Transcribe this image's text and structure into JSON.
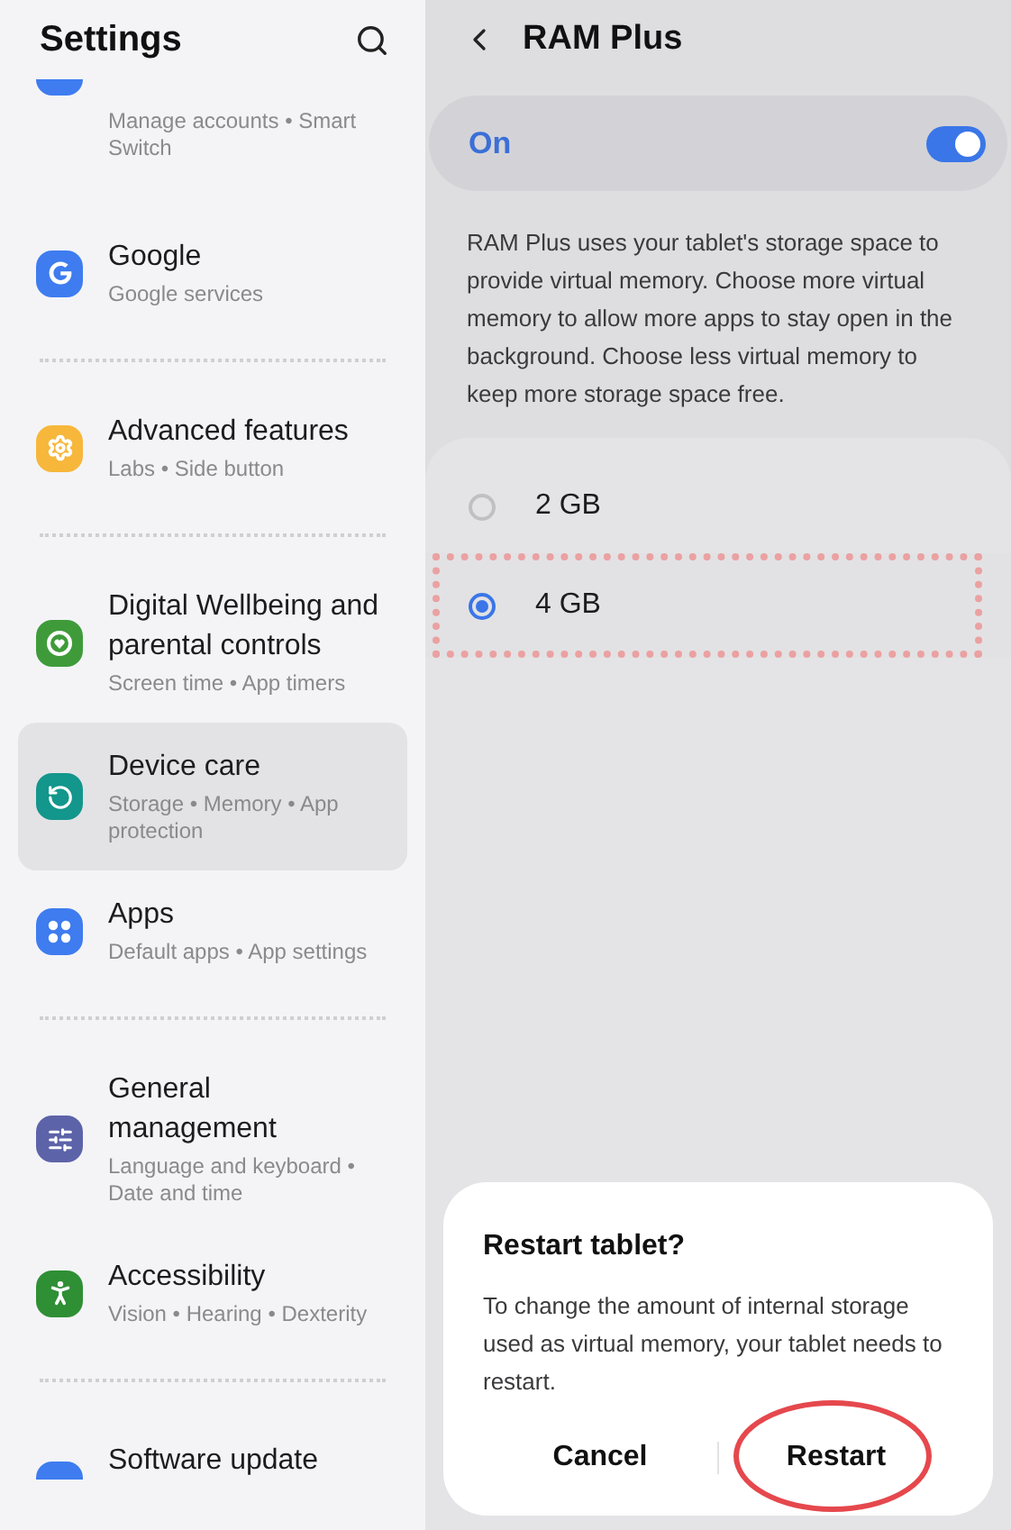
{
  "sidebar": {
    "title": "Settings",
    "groups": [
      {
        "items": [
          {
            "kind": "backup",
            "subtitle": "Manage accounts • Smart Switch",
            "color": "#3e7cf0",
            "selected": false
          },
          {
            "kind": "google",
            "title": "Google",
            "subtitle": "Google services",
            "color": "#3e7cf0",
            "selected": false
          }
        ]
      },
      {
        "items": [
          {
            "kind": "advanced",
            "title": "Advanced features",
            "subtitle": "Labs • Side button",
            "color": "#f7b73b",
            "selected": false
          }
        ]
      },
      {
        "items": [
          {
            "kind": "wellbeing",
            "title": "Digital Wellbeing and parental controls",
            "subtitle": "Screen time • App timers",
            "color": "#3f9b3a",
            "selected": false
          },
          {
            "kind": "care",
            "title": "Device care",
            "subtitle": "Storage • Memory • App protection",
            "color": "#13968c",
            "selected": true
          },
          {
            "kind": "apps",
            "title": "Apps",
            "subtitle": "Default apps • App settings",
            "color": "#3e7cf0",
            "selected": false
          }
        ]
      },
      {
        "items": [
          {
            "kind": "general",
            "title": "General management",
            "subtitle": "Language and keyboard • Date and time",
            "color": "#5d63a8",
            "selected": false
          },
          {
            "kind": "accessibility",
            "title": "Accessibility",
            "subtitle": "Vision • Hearing • Dexterity",
            "color": "#2f8f35",
            "selected": false
          }
        ]
      },
      {
        "items": [
          {
            "kind": "update",
            "title": "Software update",
            "color": "#3e7cf0",
            "selected": false
          }
        ]
      }
    ]
  },
  "page": {
    "title": "RAM Plus",
    "master_switch": {
      "label": "On",
      "on": true
    },
    "description": "RAM Plus uses your tablet's storage space to provide virtual memory. Choose more virtual memory to allow more apps to stay open in the background. Choose less virtual memory to keep more storage space free.",
    "options": [
      {
        "label": "2 GB",
        "selected": false,
        "highlighted": false
      },
      {
        "label": "4 GB",
        "selected": true,
        "highlighted": true
      }
    ]
  },
  "dialog": {
    "title": "Restart tablet?",
    "message": "To change the amount of internal storage used as virtual memory, your tablet needs to restart.",
    "buttons": [
      {
        "label": "Cancel",
        "circled": false
      },
      {
        "label": "Restart",
        "circled": true
      }
    ]
  }
}
